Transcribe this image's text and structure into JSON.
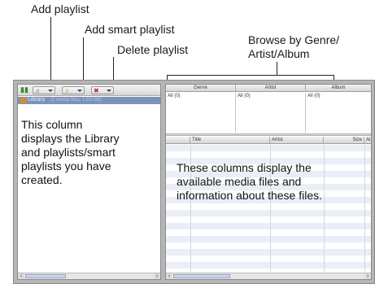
{
  "callouts": {
    "add_playlist": "Add playlist",
    "add_smart_playlist": "Add smart playlist",
    "delete_playlist": "Delete playlist",
    "browse_line1": "Browse by Genre/",
    "browse_line2": "Artist/Album"
  },
  "left_pane": {
    "library_label": "Library",
    "library_sub": "(3 media files, 1.53 GB)",
    "description": "This column\ndisplays the Library\nand playlists/smart\nplaylists you have\ncreated."
  },
  "browser": {
    "headers": [
      "Genre",
      "Artist",
      "Album"
    ],
    "all_items": [
      "All (0)",
      "All (0)",
      "All (0)"
    ]
  },
  "files": {
    "headers": [
      "",
      "Title",
      "Artist",
      "Size",
      "Al"
    ],
    "description": "These columns display the\navailable media files and\ninformation about these files."
  },
  "colors": {
    "selection": "#7b93b8",
    "stripe": "#e9eef7",
    "window": "#b5b5b5"
  },
  "icons": {
    "add_playlist": "add-playlist-icon",
    "add_smart_playlist": "add-smart-playlist-icon",
    "delete_playlist": "delete-playlist-icon"
  }
}
